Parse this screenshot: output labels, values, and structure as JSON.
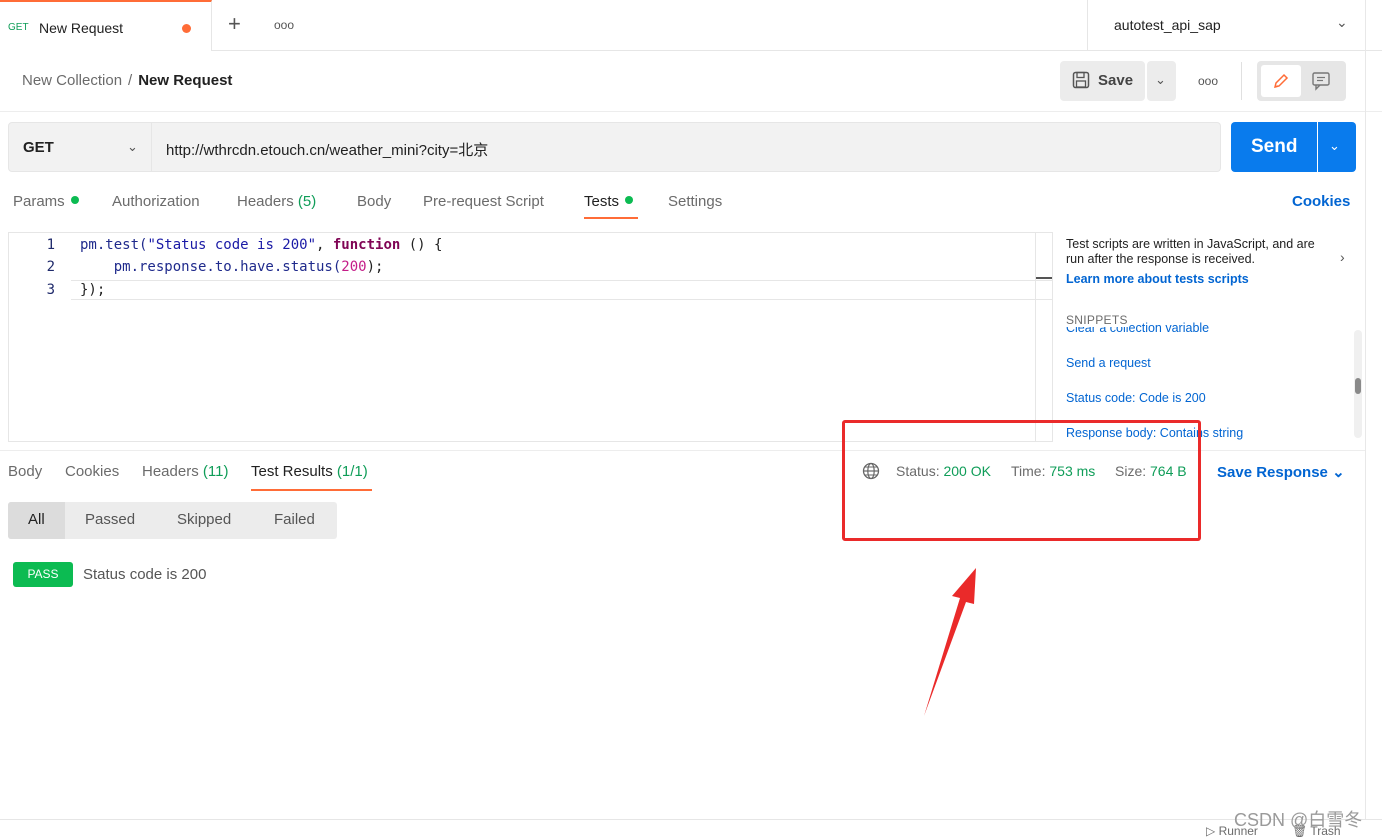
{
  "tab": {
    "method": "GET",
    "title": "New Request",
    "plus": "+",
    "more": "ooo"
  },
  "environment": {
    "name": "autotest_api_sap"
  },
  "breadcrumb": {
    "collection": "New Collection",
    "separator": "/",
    "request": "New Request"
  },
  "toolbar": {
    "save_label": "Save",
    "more": "ooo"
  },
  "request": {
    "method": "GET",
    "url": "http://wthrcdn.etouch.cn/weather_mini?city=北京",
    "send_label": "Send"
  },
  "request_tabs": [
    {
      "label": "Params",
      "dot": true
    },
    {
      "label": "Authorization"
    },
    {
      "label": "Headers",
      "count": "(5)"
    },
    {
      "label": "Body"
    },
    {
      "label": "Pre-request Script"
    },
    {
      "label": "Tests",
      "dot": true,
      "active": true
    },
    {
      "label": "Settings"
    }
  ],
  "cookies_label": "Cookies",
  "editor": {
    "line_numbers": [
      "1",
      "2",
      "3"
    ],
    "lines": {
      "l1_a": "pm.test(",
      "l1_str": "\"Status code is 200\"",
      "l1_b": ", ",
      "l1_kw": "function",
      "l1_c": " () {",
      "l2_a": "    pm.response.to.have.status(",
      "l2_num": "200",
      "l2_b": ");",
      "l3": "});"
    }
  },
  "side_panel": {
    "description": "Test scripts are written in JavaScript, and are run after the response is received.",
    "learn_more": "Learn more about tests scripts",
    "snippets_title": "SNIPPETS",
    "snippets": [
      "Clear a collection variable",
      "Send a request",
      "Status code: Code is 200",
      "Response body: Contains string"
    ]
  },
  "response_tabs": [
    {
      "label": "Body"
    },
    {
      "label": "Cookies"
    },
    {
      "label": "Headers",
      "count": "(11)"
    },
    {
      "label": "Test Results",
      "count": "(1/1)",
      "active": true
    }
  ],
  "response_meta": {
    "status_label": "Status:",
    "status_value": "200 OK",
    "time_label": "Time:",
    "time_value": "753 ms",
    "size_label": "Size:",
    "size_value": "764 B",
    "save_response": "Save Response"
  },
  "filters": [
    "All",
    "Passed",
    "Skipped",
    "Failed"
  ],
  "results": [
    {
      "badge": "PASS",
      "name": "Status code is 200"
    }
  ],
  "bottom": {
    "runner": "Runner",
    "trash": "Trash"
  },
  "watermark": "CSDN @白雪冬",
  "colors": {
    "accent": "#ff6c37",
    "primary": "#097bed",
    "success": "#0cbb52",
    "link": "#0265d2",
    "annotation": "#ea2a2a"
  }
}
